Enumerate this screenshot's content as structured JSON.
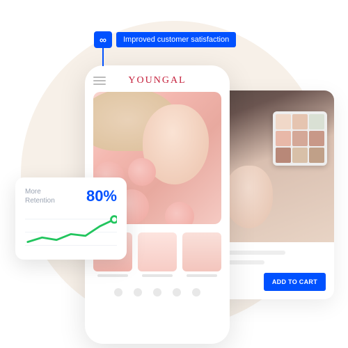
{
  "badge": {
    "icon": "∞",
    "text": "Improved customer satisfaction"
  },
  "phone": {
    "brand": "YOUNGAL"
  },
  "sideCard": {
    "button": "ADD TO CART"
  },
  "retention": {
    "label_line1": "More",
    "label_line2": "Retention",
    "percent": "80%"
  },
  "chart_data": {
    "type": "line",
    "x": [
      0,
      1,
      2,
      3,
      4,
      5,
      6
    ],
    "values": [
      12,
      25,
      18,
      35,
      30,
      58,
      78
    ],
    "ylim": [
      0,
      100
    ],
    "color": "#22c55e"
  },
  "colors": {
    "accent": "#0051ff",
    "brand": "#c41e3a",
    "chart": "#22c55e"
  }
}
